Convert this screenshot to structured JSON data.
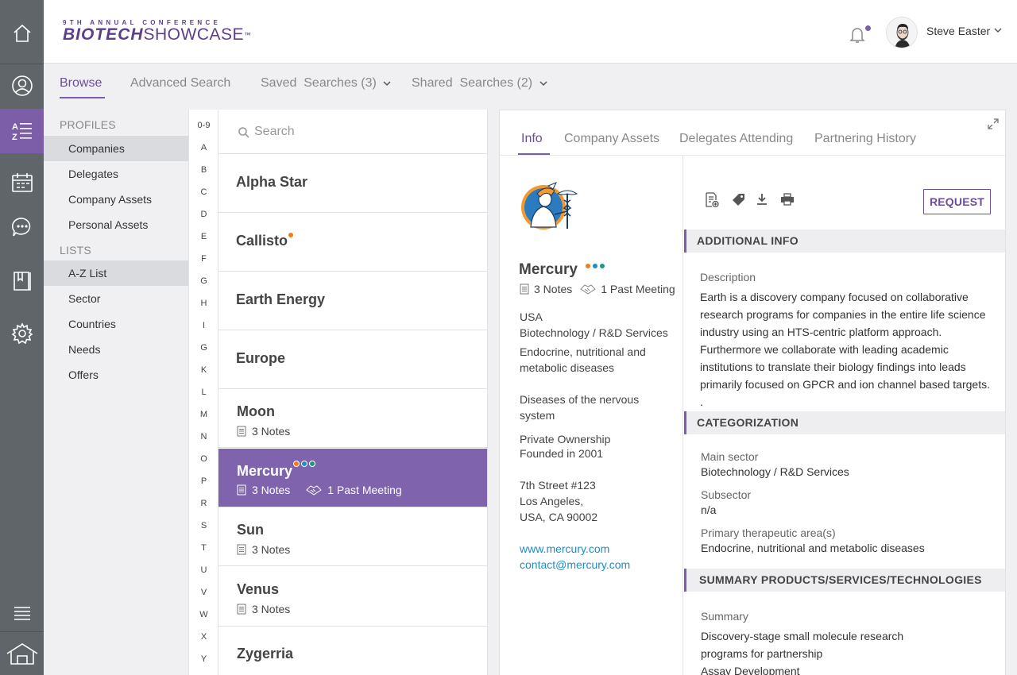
{
  "header": {
    "logo_top": "9TH ANNUAL CONFERENCE",
    "logo_bold": "BIOTECH",
    "logo_light": "SHOWCASE",
    "logo_tm": "™",
    "user_name": "Steve Easter"
  },
  "rail": {
    "icons": [
      "home-icon",
      "profile-icon",
      "az-list-icon",
      "calendar-icon",
      "chat-icon",
      "book-icon",
      "settings-icon",
      "menu-icon",
      "exit-home-icon"
    ],
    "active_label": "A Z"
  },
  "nav": {
    "browse": "Browse",
    "advanced_search": "Advanced Search",
    "saved_searches": "Saved  Searches (3)",
    "shared_searches": "Shared  Searches (2)"
  },
  "categories": {
    "profiles_heading": "PROFILES",
    "profiles": [
      "Companies",
      "Delegates",
      "Company Assets",
      "Personal Assets"
    ],
    "lists_heading": "LISTS",
    "lists": [
      "A-Z List",
      "Sector",
      "Countries",
      "Needs",
      "Offers"
    ]
  },
  "alphabet": [
    "0-9",
    "A",
    "B",
    "C",
    "D",
    "E",
    "F",
    "G",
    "H",
    "I",
    "G",
    "K",
    "L",
    "M",
    "N",
    "O",
    "P",
    "R",
    "S",
    "T",
    "U",
    "V",
    "W",
    "X",
    "Y"
  ],
  "search": {
    "placeholder": "Search",
    "value": ""
  },
  "companies": [
    {
      "name": "Alpha Star"
    },
    {
      "name": "Callisto"
    },
    {
      "name": "Earth Energy"
    },
    {
      "name": "Europe"
    },
    {
      "name": "Moon",
      "notes": "3 Notes"
    },
    {
      "name": "Mercury",
      "notes": "3 Notes",
      "meetings": "1 Past Meeting"
    },
    {
      "name": "Sun",
      "notes": "3 Notes"
    },
    {
      "name": "Venus",
      "notes": "3 Notes"
    },
    {
      "name": "Zygerria"
    }
  ],
  "colors": {
    "accent": "#7b5ea7",
    "dot_orange": "#f07d1a",
    "dot_blue": "#1b8fc4",
    "dot_teal": "#1a9a86",
    "link": "#1b8fc4"
  },
  "detail": {
    "tabs": [
      "Info",
      "Company Assets",
      "Delegates Attending",
      "Partnering History"
    ],
    "company_name": "Mercury",
    "notes": "3 Notes",
    "meetings": "1 Past Meeting",
    "country": "USA",
    "sector": "Biotechnology / R&D Services",
    "area_1": "Endocrine, nutritional and metabolic diseases",
    "area_2": "Diseases of the nervous system",
    "ownership": "Private Ownership",
    "founded": "Founded in 2001",
    "address_1": "7th Street #123",
    "address_2": "Los Angeles,",
    "address_3": "USA, CA 90002",
    "website": "www.mercury.com",
    "email": "contact@mercury.com",
    "request_label": "REQUEST",
    "additional_info_heading": "ADDITIONAL INFO",
    "description_label": "Description",
    "description": "Earth  is a discovery company focused on collaborative research programs for companies in the entire life science industry using an HTS-centric platform approach. Furthermore we collaborate with leading academic institutions to translate their biology findings into leads primarily focused on GPCR and ion channel based targets. .",
    "categorization_heading": "CATEGORIZATION",
    "main_sector_label": "Main sector",
    "main_sector": "Biotechnology / R&D Services",
    "subsector_label": "Subsector",
    "subsector": "n/a",
    "therapeutic_label": "Primary therapeutic area(s)",
    "therapeutic": "Endocrine, nutritional and metabolic diseases",
    "summary_heading": "SUMMARY PRODUCTS/SERVICES/TECHNOLOGIES",
    "summary_label": "Summary",
    "summary_1": "Discovery-stage small molecule research",
    "summary_2": "programs for partnership",
    "summary_3": "Assay Development"
  }
}
